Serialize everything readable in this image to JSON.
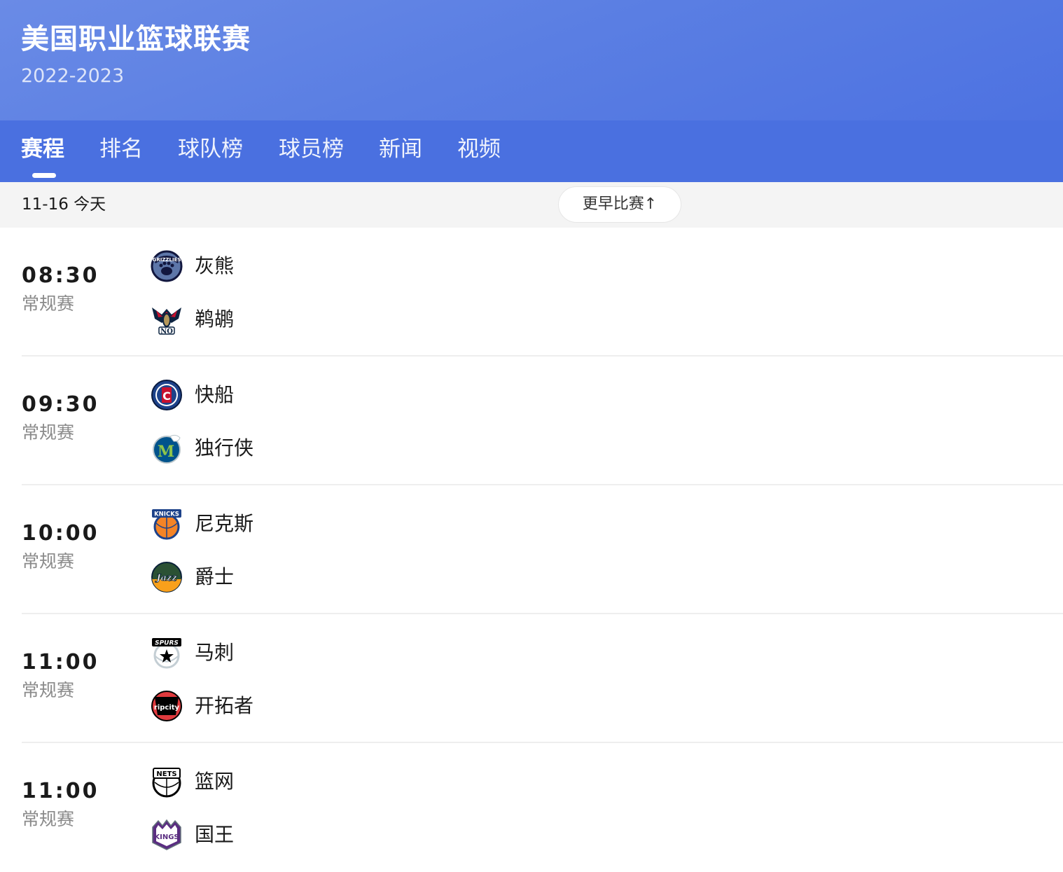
{
  "header": {
    "title": "美国职业篮球联赛",
    "season": "2022-2023"
  },
  "tabs": [
    {
      "label": "赛程",
      "active": true
    },
    {
      "label": "排名"
    },
    {
      "label": "球队榜"
    },
    {
      "label": "球员榜"
    },
    {
      "label": "新闻"
    },
    {
      "label": "视频"
    }
  ],
  "date_bar": {
    "date": "11-16 今天",
    "earlier_button": "更早比赛"
  },
  "matches": [
    {
      "time": "08:30",
      "stage": "常规赛",
      "home": {
        "name": "灰熊",
        "logo": "grizzlies-logo",
        "logo_text": "GRIZZLIES"
      },
      "away": {
        "name": "鹈鹕",
        "logo": "pelicans-logo",
        "logo_text": "NO"
      }
    },
    {
      "time": "09:30",
      "stage": "常规赛",
      "home": {
        "name": "快船",
        "logo": "clippers-logo",
        "logo_text": "C"
      },
      "away": {
        "name": "独行侠",
        "logo": "mavericks-logo",
        "logo_text": "M"
      }
    },
    {
      "time": "10:00",
      "stage": "常规赛",
      "home": {
        "name": "尼克斯",
        "logo": "knicks-logo",
        "logo_text": "KNICKS"
      },
      "away": {
        "name": "爵士",
        "logo": "jazz-logo",
        "logo_text": "Jazz"
      }
    },
    {
      "time": "11:00",
      "stage": "常规赛",
      "home": {
        "name": "马刺",
        "logo": "spurs-logo",
        "logo_text": "SPURS"
      },
      "away": {
        "name": "开拓者",
        "logo": "blazers-logo",
        "logo_text": "ripcity"
      }
    },
    {
      "time": "11:00",
      "stage": "常规赛",
      "home": {
        "name": "篮网",
        "logo": "nets-logo",
        "logo_text": "NETS"
      },
      "away": {
        "name": "国王",
        "logo": "kings-logo",
        "logo_text": "KINGS"
      }
    }
  ],
  "colors": {
    "header_gradient_start": "#6a8be6",
    "header_gradient_end": "#4d72e1",
    "tab_bar": "#4a70e0",
    "date_bar_bg": "#f4f4f4",
    "divider": "#eeeeee"
  }
}
